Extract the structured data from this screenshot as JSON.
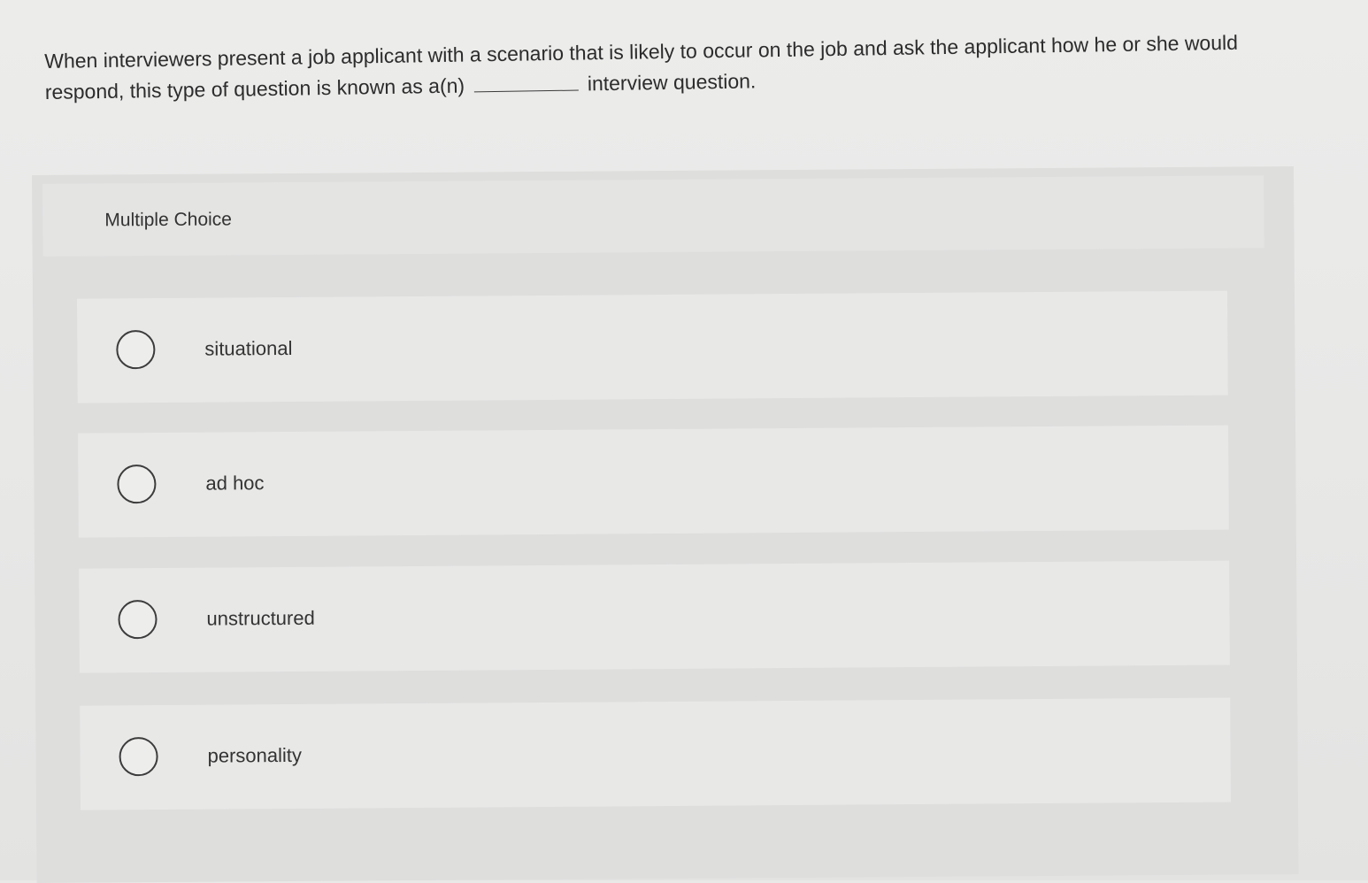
{
  "question": {
    "text_before": "When interviewers present a job applicant with a scenario that is likely to occur on the job and ask the applicant how he or she would respond, this type of question is known as a(n)",
    "text_after": "interview question."
  },
  "multiple_choice": {
    "header_label": "Multiple Choice",
    "options": [
      {
        "label": "situational"
      },
      {
        "label": "ad hoc"
      },
      {
        "label": "unstructured"
      },
      {
        "label": "personality"
      }
    ]
  }
}
